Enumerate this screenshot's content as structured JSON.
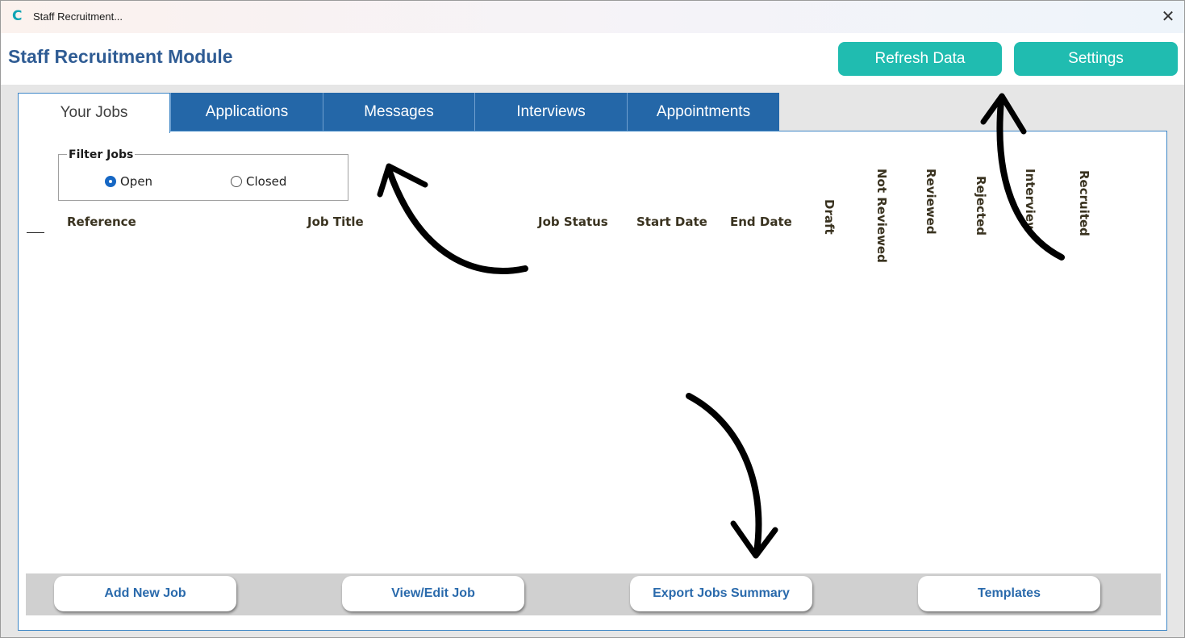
{
  "window": {
    "title": "Staff Recruitment...",
    "close_glyph": "✕",
    "app_icon_glyph": "C"
  },
  "header": {
    "module_title": "Staff Recruitment Module",
    "refresh_label": "Refresh Data",
    "settings_label": "Settings"
  },
  "tabs": [
    {
      "label": "Your Jobs",
      "active": true
    },
    {
      "label": "Applications",
      "active": false
    },
    {
      "label": "Messages",
      "active": false
    },
    {
      "label": "Interviews",
      "active": false
    },
    {
      "label": "Appointments",
      "active": false
    }
  ],
  "filter": {
    "legend": "Filter Jobs",
    "options": [
      {
        "label": "Open",
        "selected": true
      },
      {
        "label": "Closed",
        "selected": false
      }
    ]
  },
  "columns": {
    "reference": "Reference",
    "job_title": "Job Title",
    "job_status": "Job Status",
    "start_date": "Start Date",
    "end_date": "End Date",
    "draft": "Draft",
    "not_reviewed": "Not Reviewed",
    "reviewed": "Reviewed",
    "rejected": "Rejected",
    "interview": "Interview",
    "recruited": "Recruited"
  },
  "footer": {
    "add_label": "Add New Job",
    "view_edit_label": "View/Edit Job",
    "export_label": "Export Jobs Summary",
    "templates_label": "Templates"
  },
  "colors": {
    "accent_teal": "#20bcb0",
    "tab_blue": "#2467a8",
    "title_blue": "#2f5c94",
    "footer_text_blue": "#2a6aac"
  }
}
